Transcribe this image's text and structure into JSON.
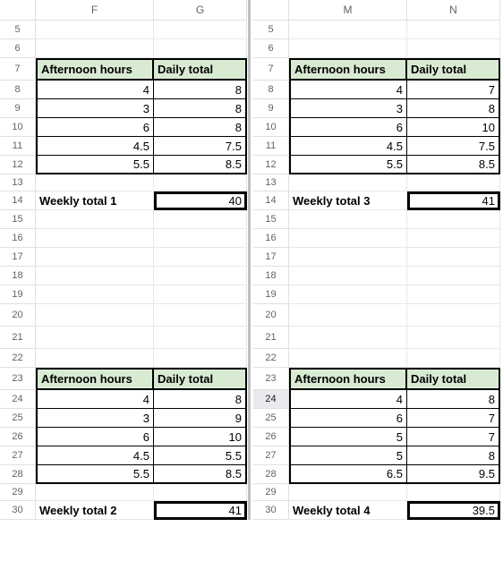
{
  "columns": {
    "left1": "F",
    "left2": "G",
    "right1": "M",
    "right2": "N"
  },
  "rows": [
    "5",
    "6",
    "7",
    "8",
    "9",
    "10",
    "11",
    "12",
    "13",
    "14",
    "15",
    "16",
    "17",
    "18",
    "19",
    "20",
    "21",
    "22",
    "23",
    "24",
    "25",
    "26",
    "27",
    "28",
    "29",
    "30"
  ],
  "row_highlight": 24,
  "headers": {
    "afternoon": "Afternoon hours",
    "daily": "Daily total"
  },
  "labels": {
    "w1": "Weekly total 1",
    "w2": "Weekly total 2",
    "w3": "Weekly total 3",
    "w4": "Weekly total 4"
  },
  "chart_data": [
    {
      "type": "table",
      "title": "Weekly total 1",
      "columns": [
        "Afternoon hours",
        "Daily total"
      ],
      "rows": [
        [
          4,
          8
        ],
        [
          3,
          8
        ],
        [
          6,
          8
        ],
        [
          4.5,
          7.5
        ],
        [
          5.5,
          8.5
        ]
      ],
      "total": 40
    },
    {
      "type": "table",
      "title": "Weekly total 2",
      "columns": [
        "Afternoon hours",
        "Daily total"
      ],
      "rows": [
        [
          4,
          8
        ],
        [
          3,
          9
        ],
        [
          6,
          10
        ],
        [
          4.5,
          5.5
        ],
        [
          5.5,
          8.5
        ]
      ],
      "total": 41
    },
    {
      "type": "table",
      "title": "Weekly total 3",
      "columns": [
        "Afternoon hours",
        "Daily total"
      ],
      "rows": [
        [
          4,
          7
        ],
        [
          3,
          8
        ],
        [
          6,
          10
        ],
        [
          4.5,
          7.5
        ],
        [
          5.5,
          8.5
        ]
      ],
      "total": 41
    },
    {
      "type": "table",
      "title": "Weekly total 4",
      "columns": [
        "Afternoon hours",
        "Daily total"
      ],
      "rows": [
        [
          4,
          8
        ],
        [
          6,
          7
        ],
        [
          5,
          7
        ],
        [
          5,
          8
        ],
        [
          6.5,
          9.5
        ]
      ],
      "total": 39.5
    }
  ]
}
